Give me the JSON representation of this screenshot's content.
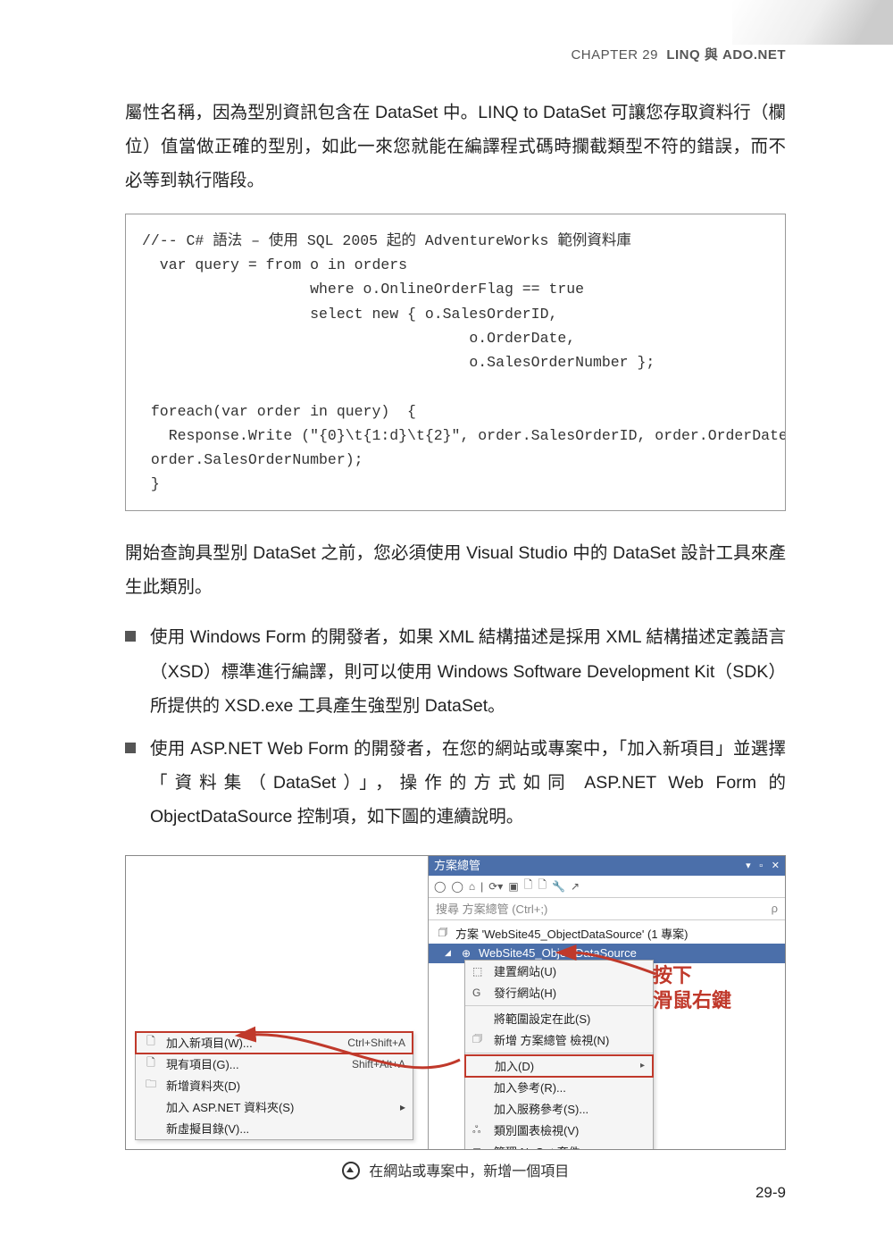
{
  "header": {
    "chapter_label": "CHAPTER 29",
    "chapter_title": "LINQ 與 ADO.NET"
  },
  "paragraphs": {
    "p1": "屬性名稱，因為型別資訊包含在 DataSet 中。LINQ to DataSet 可讓您存取資料行（欄位）值當做正確的型別，如此一來您就能在編譯程式碼時攔截類型不符的錯誤，而不必等到執行階段。",
    "p2": "開始查詢具型別 DataSet 之前，您必須使用 Visual Studio 中的 DataSet 設計工具來產生此類別。"
  },
  "code": "//-- C# 語法 – 使用 SQL 2005 起的 AdventureWorks 範例資料庫\n  var query = from o in orders\n                   where o.OnlineOrderFlag == true\n                   select new { o.SalesOrderID,\n                                     o.OrderDate,\n                                     o.SalesOrderNumber };\n\n foreach(var order in query)  {\n   Response.Write (\"{0}\\t{1:d}\\t{2}\", order.SalesOrderID, order.OrderDate,\n order.SalesOrderNumber);\n }",
  "bullets": {
    "b1": "使用 Windows Form 的開發者，如果 XML 結構描述是採用 XML 結構描述定義語言（XSD）標準進行編譯，則可以使用 Windows Software Development Kit（SDK）所提供的 XSD.exe 工具產生強型別 DataSet。",
    "b2": "使用 ASP.NET Web Form 的開發者，在您的網站或專案中，「加入新項目」並選擇「資料集（DataSet）」，操作的方式如同 ASP.NET Web Form 的 ObjectDataSource 控制項，如下圖的連續說明。"
  },
  "figure": {
    "solution_title": "方案總管",
    "search_placeholder": "搜尋 方案總管 (Ctrl+;)",
    "search_icon": "ρ",
    "solution_line": "方案 'WebSite45_ObjectDataSource' (1 專案)",
    "project_name": "WebSite45_ObjectDataSource",
    "submenu": {
      "i1": "建置網站(U)",
      "i2": "發行網站(H)",
      "i3": "將範圍設定在此(S)",
      "i4": "新增 方案總管 檢視(N)",
      "i5": "加入(D)",
      "i6": "加入參考(R)...",
      "i7": "加入服務參考(S)...",
      "i8": "類別圖表檢視(V)",
      "i9": "管理 NuGet 套件..."
    },
    "ctxmenu": {
      "c1_label": "加入新項目(W)...",
      "c1_shortcut": "Ctrl+Shift+A",
      "c2_label": "現有項目(G)...",
      "c2_shortcut": "Shift+Alt+A",
      "c3_label": "新增資料夾(D)",
      "c4_label": "加入 ASP.NET 資料夾(S)",
      "c5_label": "新虛擬目錄(V)..."
    },
    "annotation": {
      "line1": "按下",
      "line2": "滑鼠右鍵"
    },
    "caption": "在網站或專案中，新增一個項目"
  },
  "page_number": "29-9"
}
